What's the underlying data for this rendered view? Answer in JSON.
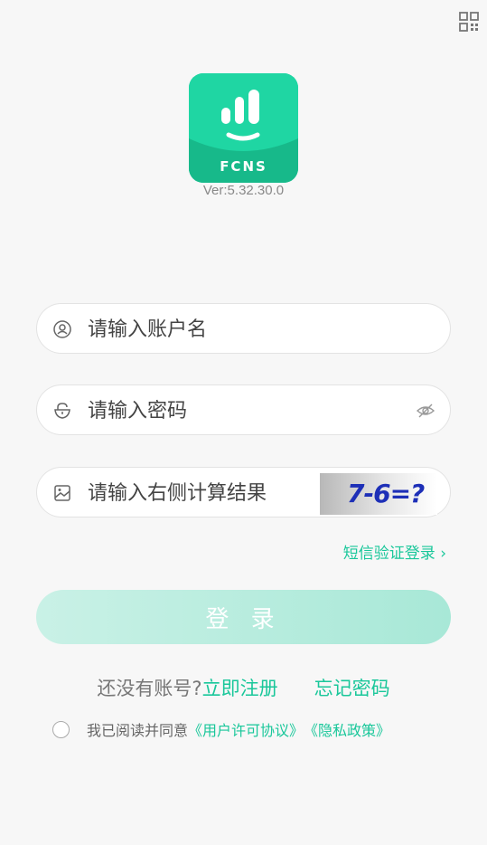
{
  "header": {
    "qr_icon": "qr-code-icon"
  },
  "app": {
    "logo_text": "FCNS",
    "version": "Ver:5.32.30.0",
    "brand_color": "#1ED39F"
  },
  "form": {
    "username": {
      "placeholder": "请输入账户名",
      "icon": "user-icon"
    },
    "password": {
      "placeholder": "请输入密码",
      "icon": "lock-icon",
      "toggle_icon": "eye-hidden-icon"
    },
    "captcha": {
      "placeholder": "请输入右侧计算结果",
      "icon": "image-icon",
      "challenge": "7-6=?"
    }
  },
  "sms_login": "短信验证登录 ›",
  "login_button": "登 录",
  "register": {
    "prompt": "还没有账号?",
    "register_link": "立即注册",
    "forgot_link": "忘记密码"
  },
  "agreement": {
    "prefix": "我已阅读并同意",
    "user_agreement": "《用户许可协议》",
    "privacy_policy": "《隐私政策》"
  },
  "accent_color": "#19C79A"
}
